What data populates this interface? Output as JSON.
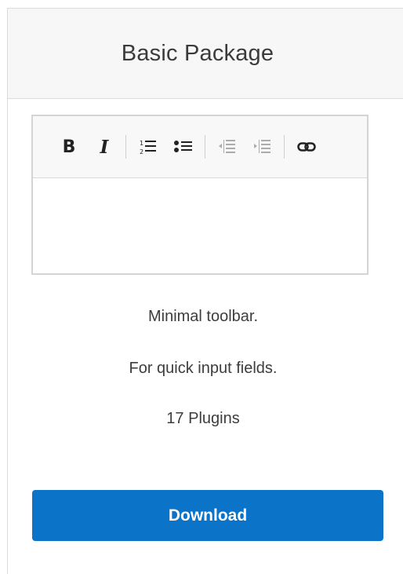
{
  "card": {
    "title": "Basic Package"
  },
  "toolbar": {
    "buttons": [
      {
        "name": "bold",
        "glyph": "B"
      },
      {
        "name": "italic",
        "glyph": "I"
      },
      {
        "name": "numbered-list",
        "glyph": "numbered-list-icon"
      },
      {
        "name": "bulleted-list",
        "glyph": "bulleted-list-icon"
      },
      {
        "name": "decrease-indent",
        "glyph": "outdent-icon",
        "disabled": true
      },
      {
        "name": "increase-indent",
        "glyph": "indent-icon",
        "disabled": true
      },
      {
        "name": "link",
        "glyph": "link-icon"
      }
    ],
    "bold_label": "B",
    "italic_label": "I"
  },
  "description": {
    "line1": "Minimal toolbar.",
    "line2": "For quick input fields.",
    "plugins": "17 Plugins"
  },
  "actions": {
    "download_label": "Download"
  },
  "colors": {
    "accent": "#0b74c9",
    "header_bg": "#f7f7f7",
    "border": "#dcdcdc"
  }
}
